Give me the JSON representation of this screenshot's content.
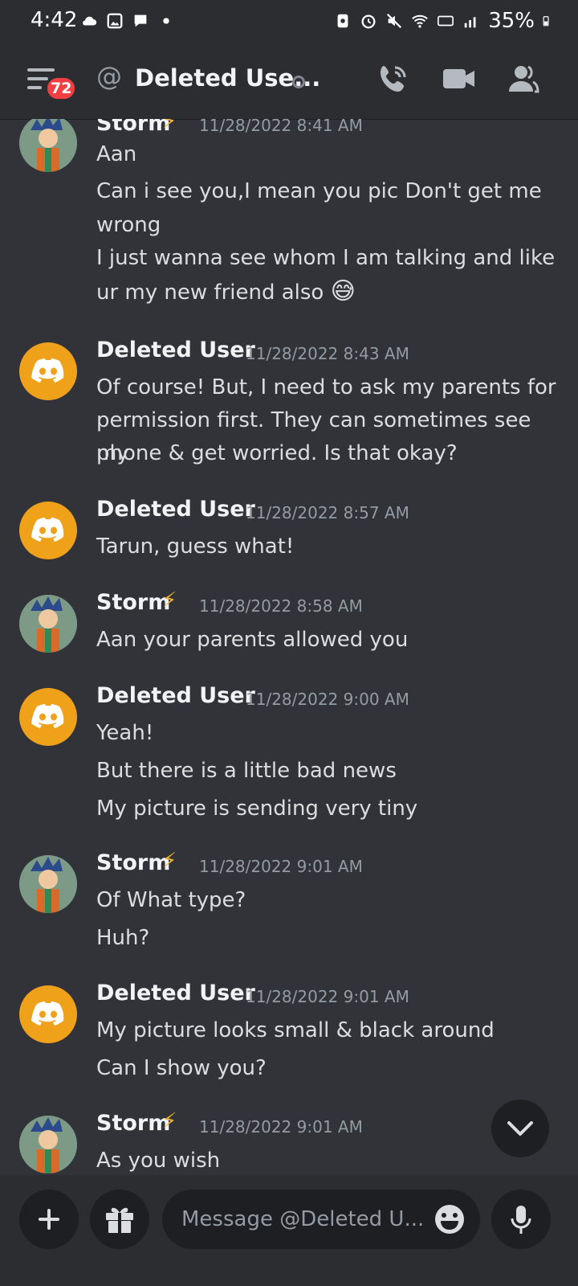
{
  "status_bar": {
    "time": "4:42",
    "battery": "35%"
  },
  "header": {
    "notification_count": "72",
    "channel_title": "Deleted Use...",
    "at_symbol": "@"
  },
  "messages": [
    {
      "author": "Storm",
      "author_emoji": "⚡",
      "timestamp": "11/28/2022 8:41 AM",
      "avatar": "storm",
      "lines": [
        "Aan",
        "Can i see you,I mean you pic Don't get me",
        "wrong",
        "I just wanna see whom I am talking and like",
        "ur my new friend also"
      ],
      "trailing_emoji": "😅"
    },
    {
      "author": "Deleted User",
      "timestamp": "11/28/2022 8:43 AM",
      "avatar": "discord",
      "lines": [
        "Of course! But, I need to ask my parents for",
        "permission first. They can sometimes see my",
        "phone & get worried. Is that okay?"
      ]
    },
    {
      "author": "Deleted User",
      "timestamp": "11/28/2022 8:57 AM",
      "avatar": "discord",
      "lines": [
        "Tarun, guess what!"
      ]
    },
    {
      "author": "Storm",
      "author_emoji": "⚡",
      "timestamp": "11/28/2022 8:58 AM",
      "avatar": "storm",
      "lines": [
        "Aan your parents allowed you"
      ]
    },
    {
      "author": "Deleted User",
      "timestamp": "11/28/2022 9:00 AM",
      "avatar": "discord",
      "lines": [
        "Yeah!",
        "But there is a little bad news",
        "My picture is sending very tiny"
      ]
    },
    {
      "author": "Storm",
      "author_emoji": "⚡",
      "timestamp": "11/28/2022 9:01 AM",
      "avatar": "storm",
      "lines": [
        "Of What type?",
        "Huh?"
      ]
    },
    {
      "author": "Deleted User",
      "timestamp": "11/28/2022 9:01 AM",
      "avatar": "discord",
      "lines": [
        "My picture looks small & black around",
        "Can I show you?"
      ]
    },
    {
      "author": "Storm",
      "author_emoji": "⚡",
      "timestamp": "11/28/2022 9:01 AM",
      "avatar": "storm",
      "lines": [
        "As you wish"
      ]
    }
  ],
  "composer": {
    "placeholder": "Message @Deleted U..."
  },
  "colors": {
    "background": "#313338",
    "bar": "#2b2d31",
    "discord_avatar": "#f0a11a",
    "badge": "#f23f43"
  }
}
